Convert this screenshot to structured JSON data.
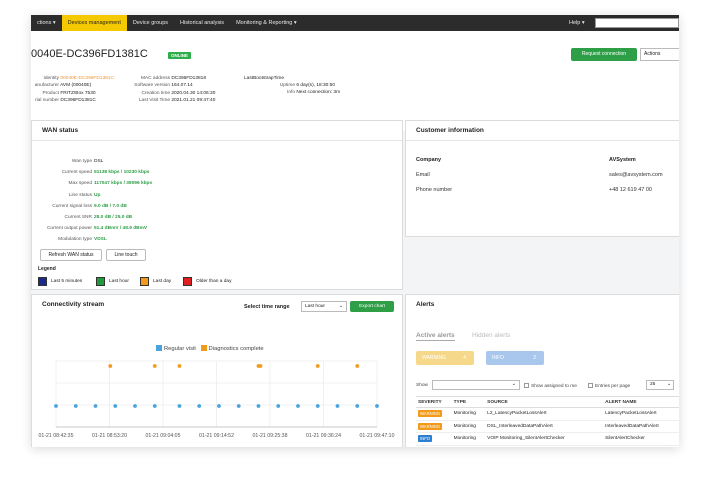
{
  "nav": {
    "items": [
      "ctions ▾",
      "Devices management",
      "Device groups",
      "Historical analysis",
      "Monitoring & Reporting ▾"
    ],
    "help": "Help ▾",
    "hint": "Device manag..."
  },
  "device": {
    "title": "0040E-DC396FD1381C",
    "status": "ONLINE",
    "request_button": "Request connection",
    "actions_select": "Actions"
  },
  "info_left": [
    {
      "k": "Identity",
      "v": "00040E-DC396FD1381C"
    },
    {
      "k": "anufacturer",
      "v": "AVM (00040E)"
    },
    {
      "k": "Product",
      "v": "FRITZ!Box 7530"
    },
    {
      "k": "rial number",
      "v": "DC396FD1381C"
    }
  ],
  "info_mid": [
    {
      "k": "MAC address",
      "v": "DC396FD13818"
    },
    {
      "k": "Software version",
      "v": "164.07.14"
    },
    {
      "k": "Creation time",
      "v": "2020.04.30 14:06:30"
    },
    {
      "k": "Last Visit Time",
      "v": "2021.01.21 09:47:40"
    }
  ],
  "info_right": {
    "bootstrap_label": "LastBootstrapTime",
    "rows": [
      {
        "k": "Uptime",
        "v": "6 day(s), 18:30:50"
      },
      {
        "k": "Info",
        "v": "Next connection: 3m"
      }
    ]
  },
  "wan": {
    "title": "WAN status",
    "rows": [
      {
        "k": "Wan type",
        "v": "DSL",
        "plain": true
      },
      {
        "k": "Current speed",
        "v": "51138 kbps / 10230 kbps"
      },
      {
        "k": "Max speed",
        "v": "117047 kbps / 39096 kbps"
      },
      {
        "k": "Line status",
        "v": "Up"
      },
      {
        "k": "Current signal loss",
        "v": "9.0 dB / 7.0 dB"
      },
      {
        "k": "Current SNR",
        "v": "28.0 dB / 25.0 dB"
      },
      {
        "k": "Current output power",
        "v": "51.4 dBmV / 48.9 dBmV"
      },
      {
        "k": "Modulation type",
        "v": "VDSL"
      }
    ],
    "refresh_button": "Refresh WAN status",
    "line_touch_button": "Line touch",
    "legend_label": "Legend",
    "legend": [
      {
        "label": "Last 5 minutes",
        "color": "#1b2a8a"
      },
      {
        "label": "Last hour",
        "color": "#1f9a3c"
      },
      {
        "label": "Last day",
        "color": "#f29a1b"
      },
      {
        "label": "Older than a day",
        "color": "#e02020"
      }
    ]
  },
  "customer": {
    "title": "Customer information",
    "company_label": "Company",
    "company": "AVSystem",
    "email_label": "Email",
    "email": "sales@avsystem.com",
    "phone_label": "Phone number",
    "phone": "+48 12 619 47 00"
  },
  "stream": {
    "title": "Connectivity stream",
    "range_label": "Select time range",
    "range_value": "Last hour",
    "export_button": "Export chart",
    "legend_regular": "Regular visit",
    "legend_diag": "Diagnostics complete",
    "color_regular": "#4aa3df",
    "color_diag": "#f29a1b"
  },
  "chart_data": {
    "type": "scatter",
    "x_ticks": [
      "01-21 08:42:35",
      "01-21 08:53:20",
      "01-21 09:04:05",
      "01-21 09:14:52",
      "01-21 09:25:38",
      "01-21 09:36:24",
      "01-21 09:47:10"
    ],
    "series": [
      {
        "name": "Regular visit",
        "x": [
          "08:42",
          "08:46",
          "08:50",
          "08:54",
          "08:58",
          "09:02",
          "09:07",
          "09:11",
          "09:15",
          "09:19",
          "09:23",
          "09:27",
          "09:31",
          "09:35",
          "09:39",
          "09:43",
          "09:47"
        ]
      },
      {
        "name": "Diagnostics complete",
        "x": [
          "08:53",
          "09:02",
          "09:07",
          "09:23",
          "09:23",
          "09:35",
          "09:43"
        ]
      }
    ],
    "grid": true,
    "legend": "top-center"
  },
  "alerts": {
    "title": "Alerts",
    "tab_active": "Active alerts",
    "tab_inactive": "Hidden alerts",
    "warning_label": "WARNING",
    "warning_count": "4",
    "info_label": "INFO",
    "info_count": "2",
    "show_label": "Show",
    "assigned_label": "Show assigned to me",
    "entries_label": "Entries per page",
    "entries_value": "25",
    "columns": [
      "SEVERITY",
      "TYPE",
      "SOURCE",
      "ALERT NAME"
    ],
    "rows": [
      {
        "severity": "WARNING",
        "sev_color": "#f29a1b",
        "type": "Monitoring",
        "source": "L2_LatencyPacketLossAlert",
        "name": "LatencyPacketLossAlert"
      },
      {
        "severity": "WARNING",
        "sev_color": "#f29a1b",
        "type": "Monitoring",
        "source": "DSL_InterleavedDataPathAlert",
        "name": "InterleavedDataPathAlert"
      },
      {
        "severity": "INFO",
        "sev_color": "#2f7fd1",
        "type": "Monitoring",
        "source": "VOIP Monitoring_SilentAlertChecker",
        "name": "SilentAlertChecker"
      }
    ]
  }
}
